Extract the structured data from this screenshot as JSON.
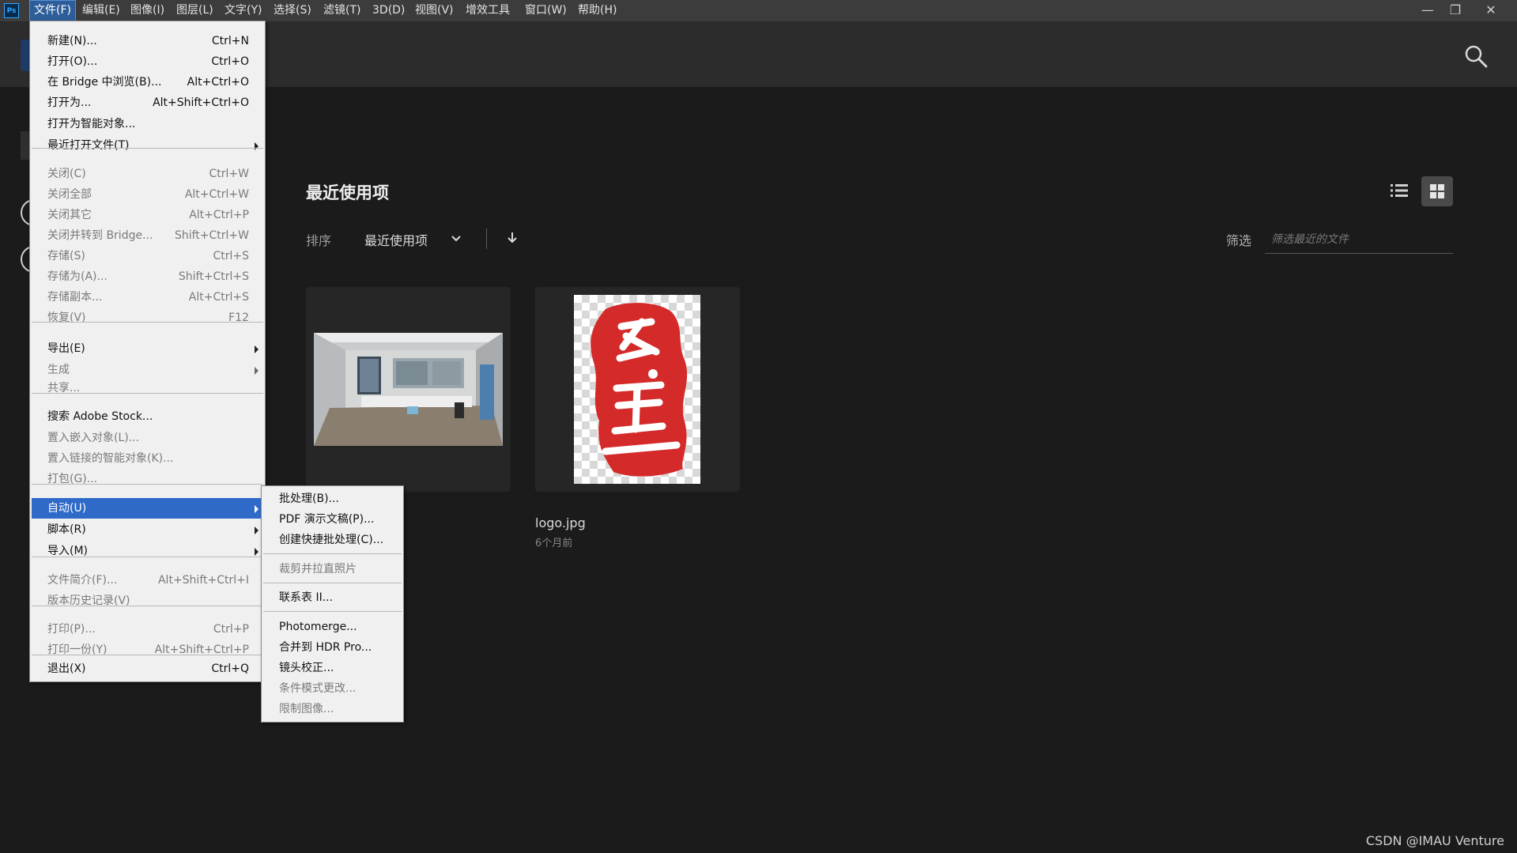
{
  "menubar": {
    "items": [
      "文件(F)",
      "编辑(E)",
      "图像(I)",
      "图层(L)",
      "文字(Y)",
      "选择(S)",
      "滤镜(T)",
      "3D(D)",
      "视图(V)",
      "增效工具",
      "窗口(W)",
      "帮助(H)"
    ],
    "active_index": 0,
    "logo": "Ps"
  },
  "window_controls": {
    "minimize": "—",
    "restore": "❐",
    "close": "✕"
  },
  "recent": {
    "title": "最近使用项",
    "sort_label": "排序",
    "sort_value": "最近使用项",
    "filter_label": "筛选",
    "filter_placeholder": "筛选最近的文件",
    "files": [
      {
        "name": "",
        "time": ""
      },
      {
        "name": "logo.jpg",
        "time": "6个月前"
      }
    ]
  },
  "file_menu": {
    "items": [
      {
        "label": "新建(N)...",
        "shortcut": "Ctrl+N",
        "disabled": false
      },
      {
        "label": "打开(O)...",
        "shortcut": "Ctrl+O",
        "disabled": false
      },
      {
        "label": "在 Bridge 中浏览(B)...",
        "shortcut": "Alt+Ctrl+O",
        "disabled": false
      },
      {
        "label": "打开为...",
        "shortcut": "Alt+Shift+Ctrl+O",
        "disabled": false
      },
      {
        "label": "打开为智能对象...",
        "shortcut": "",
        "disabled": false
      },
      {
        "label": "最近打开文件(T)",
        "shortcut": "",
        "disabled": false,
        "submenu": true
      },
      {
        "label": "关闭(C)",
        "shortcut": "Ctrl+W",
        "disabled": true
      },
      {
        "label": "关闭全部",
        "shortcut": "Alt+Ctrl+W",
        "disabled": true
      },
      {
        "label": "关闭其它",
        "shortcut": "Alt+Ctrl+P",
        "disabled": true
      },
      {
        "label": "关闭并转到 Bridge...",
        "shortcut": "Shift+Ctrl+W",
        "disabled": true
      },
      {
        "label": "存储(S)",
        "shortcut": "Ctrl+S",
        "disabled": true
      },
      {
        "label": "存储为(A)...",
        "shortcut": "Shift+Ctrl+S",
        "disabled": true
      },
      {
        "label": "存储副本...",
        "shortcut": "Alt+Ctrl+S",
        "disabled": true
      },
      {
        "label": "恢复(V)",
        "shortcut": "F12",
        "disabled": true
      },
      {
        "label": "导出(E)",
        "shortcut": "",
        "disabled": false,
        "submenu": true
      },
      {
        "label": "生成",
        "shortcut": "",
        "disabled": true,
        "submenu": true
      },
      {
        "label": "共享...",
        "shortcut": "",
        "disabled": true
      },
      {
        "label": "搜索 Adobe Stock...",
        "shortcut": "",
        "disabled": false
      },
      {
        "label": "置入嵌入对象(L)...",
        "shortcut": "",
        "disabled": true
      },
      {
        "label": "置入链接的智能对象(K)...",
        "shortcut": "",
        "disabled": true
      },
      {
        "label": "打包(G)...",
        "shortcut": "",
        "disabled": true
      },
      {
        "label": "自动(U)",
        "shortcut": "",
        "disabled": false,
        "submenu": true,
        "highlighted": true
      },
      {
        "label": "脚本(R)",
        "shortcut": "",
        "disabled": false,
        "submenu": true
      },
      {
        "label": "导入(M)",
        "shortcut": "",
        "disabled": false,
        "submenu": true
      },
      {
        "label": "文件简介(F)...",
        "shortcut": "Alt+Shift+Ctrl+I",
        "disabled": true
      },
      {
        "label": "版本历史记录(V)",
        "shortcut": "",
        "disabled": true
      },
      {
        "label": "打印(P)...",
        "shortcut": "Ctrl+P",
        "disabled": true
      },
      {
        "label": "打印一份(Y)",
        "shortcut": "Alt+Shift+Ctrl+P",
        "disabled": true
      },
      {
        "label": "退出(X)",
        "shortcut": "Ctrl+Q",
        "disabled": false
      }
    ]
  },
  "automate_menu": {
    "items": [
      {
        "label": "批处理(B)...",
        "disabled": false
      },
      {
        "label": "PDF 演示文稿(P)...",
        "disabled": false
      },
      {
        "label": "创建快捷批处理(C)...",
        "disabled": false
      },
      {
        "label": "裁剪并拉直照片",
        "disabled": true
      },
      {
        "label": "联系表 II...",
        "disabled": false
      },
      {
        "label": "Photomerge...",
        "disabled": false
      },
      {
        "label": "合并到 HDR Pro...",
        "disabled": false
      },
      {
        "label": "镜头校正...",
        "disabled": false
      },
      {
        "label": "条件模式更改...",
        "disabled": true
      },
      {
        "label": "限制图像...",
        "disabled": true
      }
    ]
  },
  "colors": {
    "menu_bg": "#f0f0f0",
    "highlight": "#2f6ac9",
    "app_bg": "#1b1b1b",
    "seal_red": "#d42a2a"
  },
  "watermark": "CSDN @IMAU Venture"
}
